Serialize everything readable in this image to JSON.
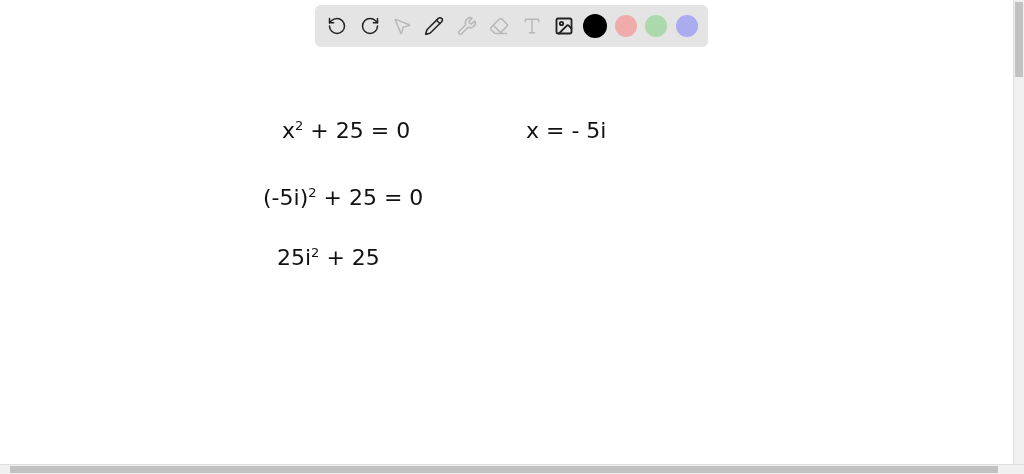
{
  "toolbar": {
    "tools": [
      {
        "kind": "undo",
        "disabled": false
      },
      {
        "kind": "redo",
        "disabled": false
      },
      {
        "kind": "select",
        "disabled": true
      },
      {
        "kind": "pen",
        "disabled": false
      },
      {
        "kind": "tools",
        "disabled": true
      },
      {
        "kind": "eraser",
        "disabled": true
      },
      {
        "kind": "text",
        "disabled": true
      },
      {
        "kind": "image",
        "disabled": false
      }
    ],
    "colors": [
      {
        "color": "#000000",
        "selected": true
      },
      {
        "color": "#f0a8a8",
        "selected": false
      },
      {
        "color": "#a8d8a8",
        "selected": false
      },
      {
        "color": "#a8a8f0",
        "selected": false
      }
    ]
  },
  "canvas": {
    "notes": [
      {
        "text": "x$^{2}$ + 25 = 0"
      },
      {
        "text": "x = - 5i"
      },
      {
        "text": "(-5i)$^{2}$ + 25 = 0"
      },
      {
        "text": "25i$^{2}$ + 25"
      }
    ]
  }
}
